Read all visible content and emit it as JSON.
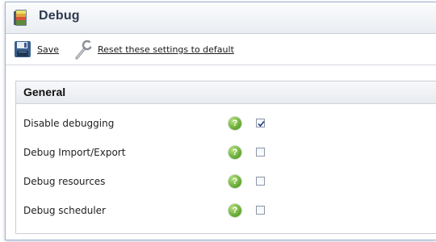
{
  "window": {
    "title": "Debug",
    "icon": "debug-book-icon"
  },
  "toolbar": {
    "save_label": "Save",
    "save_icon": "floppy-disk-icon",
    "reset_label": "Reset these settings to default",
    "reset_icon": "wrench-icon"
  },
  "panel": {
    "title": "General",
    "rows": [
      {
        "label": "Disable debugging",
        "checked": true
      },
      {
        "label": "Debug Import/Export",
        "checked": false
      },
      {
        "label": "Debug resources",
        "checked": false
      },
      {
        "label": "Debug scheduler",
        "checked": false
      }
    ],
    "help_symbol": "?"
  },
  "colors": {
    "help_green": "#5ea52d",
    "title_text": "#2e3b4e",
    "checkmark": "#1f3a8a"
  }
}
